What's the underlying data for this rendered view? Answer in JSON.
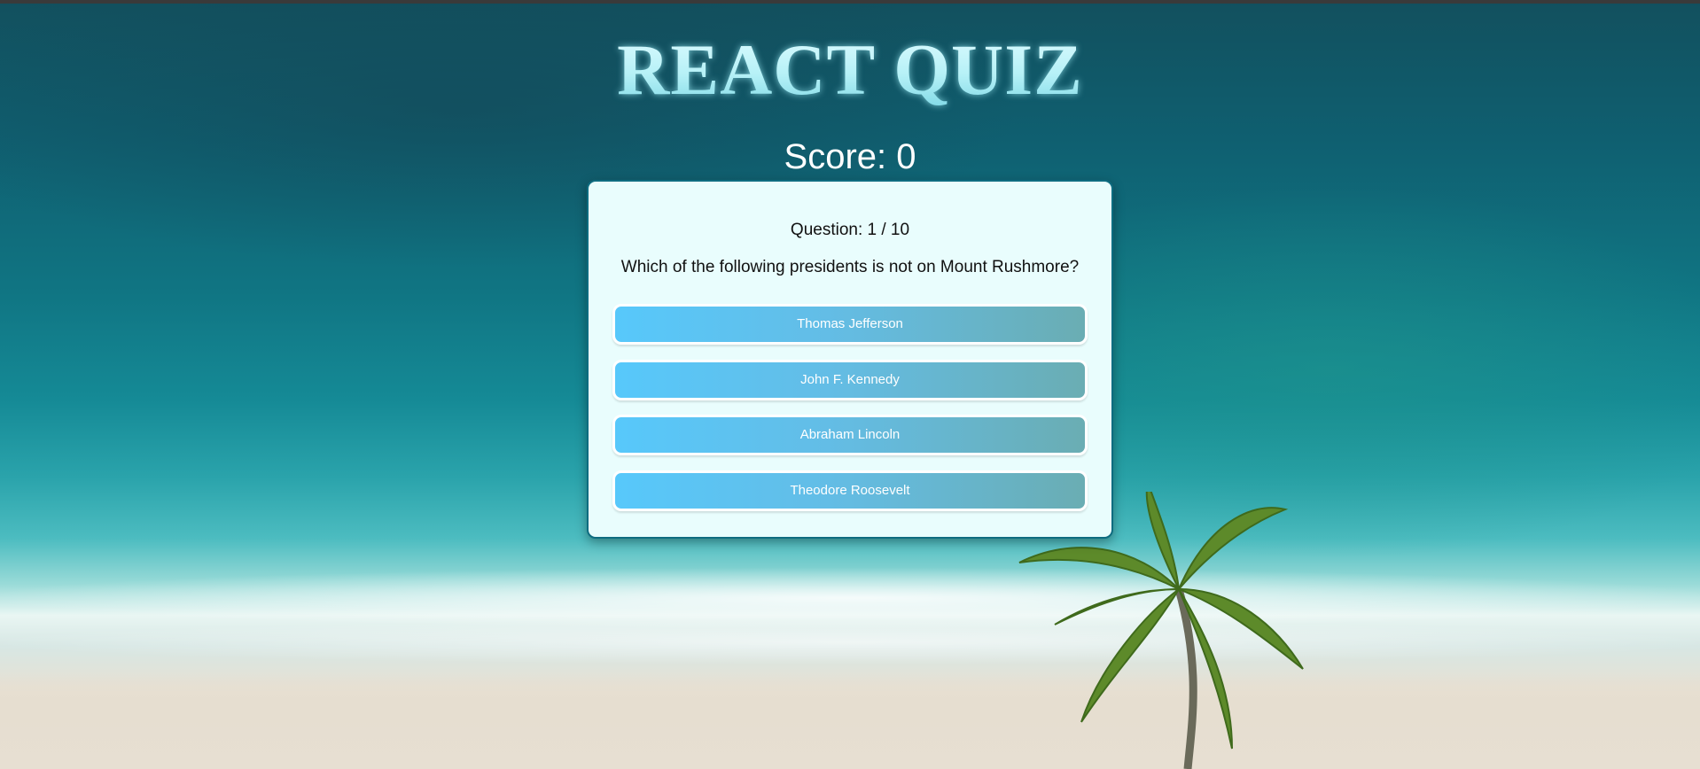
{
  "app": {
    "title": "REACT QUIZ"
  },
  "score": {
    "label": "Score: 0"
  },
  "question": {
    "counter": "Question: 1 / 10",
    "text": "Which of the following presidents is not on Mount Rushmore?",
    "answers": [
      "Thomas Jefferson",
      "John F. Kennedy",
      "Abraham Lincoln",
      "Theodore Roosevelt"
    ]
  },
  "colors": {
    "title": "#c8f7fb",
    "card_background": "#e9fdfd",
    "card_border": "#0e6c80",
    "answer_gradient_start": "#57c8fb",
    "answer_gradient_end": "#6aadb3"
  },
  "background": {
    "image": "beach-ocean-palm-photo"
  }
}
